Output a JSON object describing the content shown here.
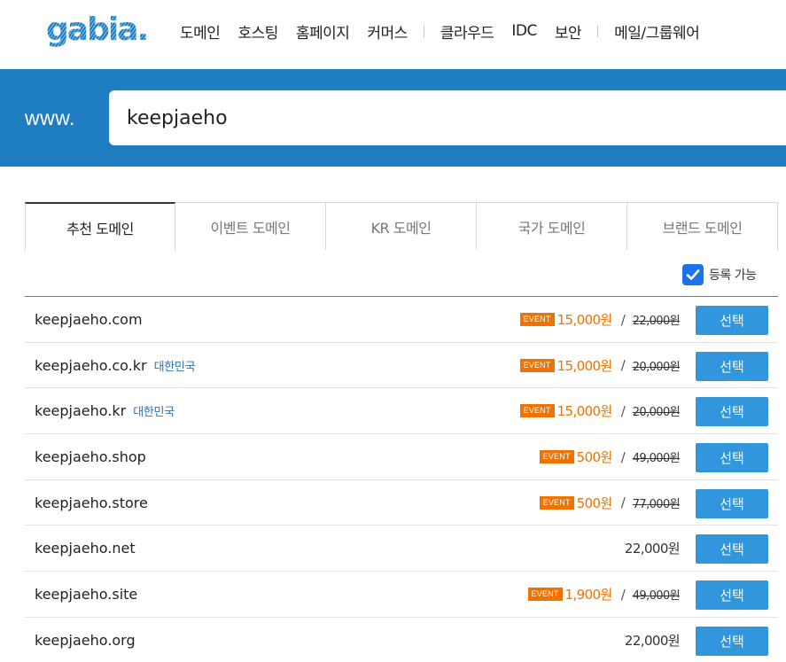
{
  "brand": {
    "logo_text": "gabia."
  },
  "nav": {
    "group1": [
      "도메인",
      "호스팅",
      "홈페이지",
      "커머스"
    ],
    "group2": [
      "클라우드",
      "IDC",
      "보안"
    ],
    "group3": [
      "메일/그룹웨어"
    ]
  },
  "search": {
    "prefix": "www.",
    "value": "keepjaeho"
  },
  "tabs": [
    "추천 도메인",
    "이벤트 도메인",
    "KR 도메인",
    "국가 도메인",
    "브랜드 도메인"
  ],
  "active_tab": "추천 도메인",
  "filter": {
    "label": "등록 가능",
    "checked": true
  },
  "select_label": "선택",
  "event_label": "EVENT",
  "colors": {
    "brand_blue": "#1f7dc1",
    "button_blue": "#3196db",
    "event_orange": "#f07200",
    "country_blue": "#2b6fb5"
  },
  "results": [
    {
      "domain": "keepjaeho.com",
      "country": "",
      "event": true,
      "sale_price": "15,000원",
      "original_price": "22,000원",
      "price": ""
    },
    {
      "domain": "keepjaeho.co.kr",
      "country": "대한민국",
      "event": true,
      "sale_price": "15,000원",
      "original_price": "20,000원",
      "price": ""
    },
    {
      "domain": "keepjaeho.kr",
      "country": "대한민국",
      "event": true,
      "sale_price": "15,000원",
      "original_price": "20,000원",
      "price": ""
    },
    {
      "domain": "keepjaeho.shop",
      "country": "",
      "event": true,
      "sale_price": "500원",
      "original_price": "49,000원",
      "price": ""
    },
    {
      "domain": "keepjaeho.store",
      "country": "",
      "event": true,
      "sale_price": "500원",
      "original_price": "77,000원",
      "price": ""
    },
    {
      "domain": "keepjaeho.net",
      "country": "",
      "event": false,
      "sale_price": "",
      "original_price": "",
      "price": "22,000원"
    },
    {
      "domain": "keepjaeho.site",
      "country": "",
      "event": true,
      "sale_price": "1,900원",
      "original_price": "49,000원",
      "price": ""
    },
    {
      "domain": "keepjaeho.org",
      "country": "",
      "event": false,
      "sale_price": "",
      "original_price": "",
      "price": "22,000원"
    }
  ]
}
